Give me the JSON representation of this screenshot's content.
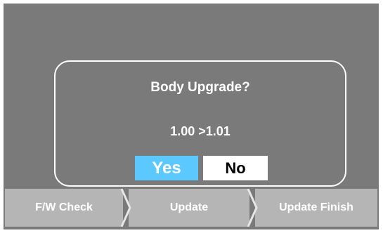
{
  "dialog": {
    "title": "Body Upgrade?",
    "version": "1.00 >1.01",
    "yes_label": "Yes",
    "no_label": "No"
  },
  "steps": [
    {
      "label": "F/W Check"
    },
    {
      "label": "Update"
    },
    {
      "label": "Update Finish"
    }
  ],
  "colors": {
    "background": "#7a7a7a",
    "yes_selected": "#5bc8ff",
    "no_button": "#ffffff",
    "step_bar": "#b5b5b5"
  },
  "icons": [
    "chevron-right-icon"
  ]
}
